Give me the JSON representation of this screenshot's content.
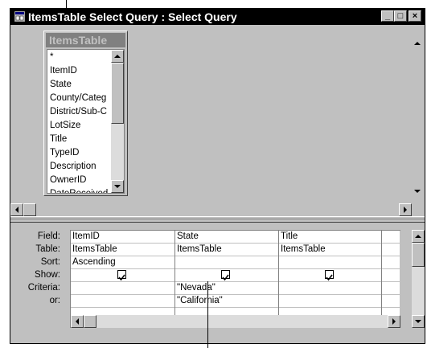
{
  "window": {
    "title": "ItemsTable Select Query : Select Query",
    "minimize_label": "_",
    "restore_label": "□",
    "close_label": "×"
  },
  "field_list": {
    "title": "ItemsTable",
    "items": [
      "*",
      "ItemID",
      "State",
      "County/Categ",
      "District/Sub-C",
      "LotSize",
      "Title",
      "TypeID",
      "Description",
      "OwnerID",
      "DateReceived"
    ]
  },
  "design_grid": {
    "row_labels": [
      "Field:",
      "Table:",
      "Sort:",
      "Show:",
      "Criteria:",
      "or:"
    ],
    "columns": [
      {
        "field": "ItemID",
        "table": "ItemsTable",
        "sort": "Ascending",
        "show": true,
        "criteria": "",
        "or": ""
      },
      {
        "field": "State",
        "table": "ItemsTable",
        "sort": "",
        "show": true,
        "criteria": "\"Nevada\"",
        "or": "\"California\""
      },
      {
        "field": "Title",
        "table": "ItemsTable",
        "sort": "",
        "show": true,
        "criteria": "",
        "or": ""
      }
    ]
  },
  "colors": {
    "titlebar": "#000000",
    "chrome": "#c0c0c0",
    "field_list_header": "#808080"
  }
}
